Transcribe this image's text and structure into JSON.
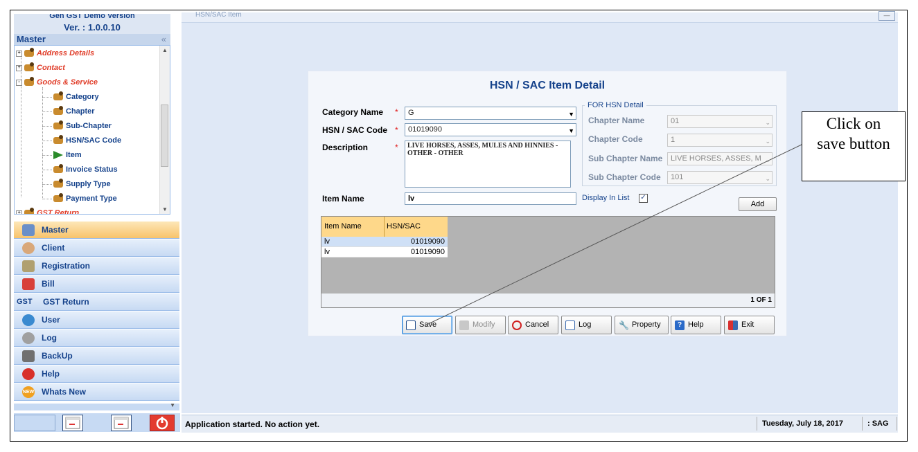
{
  "app": {
    "version_top": "Gen GST Demo Version",
    "version": "Ver. : 1.0.0.10",
    "tab_title": "HSN/SAC Item"
  },
  "sidebar": {
    "header": "Master",
    "collapse_symbol": "«",
    "tree": [
      {
        "label": "Address Details",
        "style": "red",
        "expander": "+"
      },
      {
        "label": "Contact",
        "style": "red",
        "expander": "+"
      },
      {
        "label": "Goods & Service",
        "style": "red",
        "expander": "-"
      },
      {
        "label": "Category",
        "style": "blue"
      },
      {
        "label": "Chapter",
        "style": "blue"
      },
      {
        "label": "Sub-Chapter",
        "style": "blue"
      },
      {
        "label": "HSN/SAC Code",
        "style": "blue"
      },
      {
        "label": "Item",
        "style": "blue",
        "selected": true
      },
      {
        "label": "Invoice Status",
        "style": "blue"
      },
      {
        "label": "Supply Type",
        "style": "blue"
      },
      {
        "label": "Payment Type",
        "style": "blue"
      },
      {
        "label": "GST Return",
        "style": "red",
        "expander": "+"
      }
    ],
    "nav": [
      {
        "label": "Master",
        "icon": "master-icon",
        "active": true,
        "color": "#6a8fc8"
      },
      {
        "label": "Client",
        "icon": "client-icon",
        "color": "#d9a87a"
      },
      {
        "label": "Registration",
        "icon": "registration-icon",
        "color": "#b0a070"
      },
      {
        "label": "Bill",
        "icon": "bill-icon",
        "color": "#d8403a"
      },
      {
        "label": "GST Return",
        "icon": "gst-icon",
        "color": "#15428b"
      },
      {
        "label": "User",
        "icon": "users-icon",
        "color": "#3a8ad0"
      },
      {
        "label": "Log",
        "icon": "log-icon",
        "color": "#909090"
      },
      {
        "label": "BackUp",
        "icon": "backup-icon",
        "color": "#707070"
      },
      {
        "label": "Help",
        "icon": "help-icon",
        "color": "#d8302a"
      },
      {
        "label": "Whats New",
        "icon": "new-badge-icon",
        "color": "#f0a020"
      }
    ]
  },
  "form": {
    "title": "HSN / SAC  Item Detail",
    "category_label": "Category Name",
    "category_value": "G",
    "hsn_label": "HSN / SAC Code",
    "hsn_value": "01019090",
    "description_label": "Description",
    "description_value": "LIVE HORSES, ASSES, MULES AND HINNIES - OTHER - OTHER",
    "required_mark": "*",
    "item_name_label": "Item Name",
    "item_name_value": "lv",
    "display_in_list_label": "Display In List",
    "display_in_list_checked": true,
    "add_label": "Add",
    "hsn_group": {
      "legend": "FOR HSN Detail",
      "chapter_name_label": "Chapter Name",
      "chapter_name_value": "01",
      "chapter_code_label": "Chapter Code",
      "chapter_code_value": "1",
      "sub_chapter_name_label": "Sub Chapter Name",
      "sub_chapter_name_value": "LIVE HORSES, ASSES, M",
      "sub_chapter_code_label": "Sub Chapter Code",
      "sub_chapter_code_value": "101"
    }
  },
  "grid": {
    "columns": [
      "Item Name",
      "HSN/SAC"
    ],
    "rows": [
      {
        "item": "lv",
        "hsn": "01019090",
        "selected": true
      },
      {
        "item": "lv",
        "hsn": "01019090",
        "selected": false
      }
    ],
    "pager": "1 OF 1"
  },
  "buttons": {
    "save": "Save",
    "modify": "Modify",
    "cancel": "Cancel",
    "log": "Log",
    "property": "Property",
    "help": "Help",
    "exit": "Exit"
  },
  "status": {
    "message": "Application started. No action yet.",
    "date": "Tuesday, July 18, 2017",
    "user": ": SAG"
  },
  "callout": {
    "line1": "Click on",
    "line2": "save button"
  }
}
